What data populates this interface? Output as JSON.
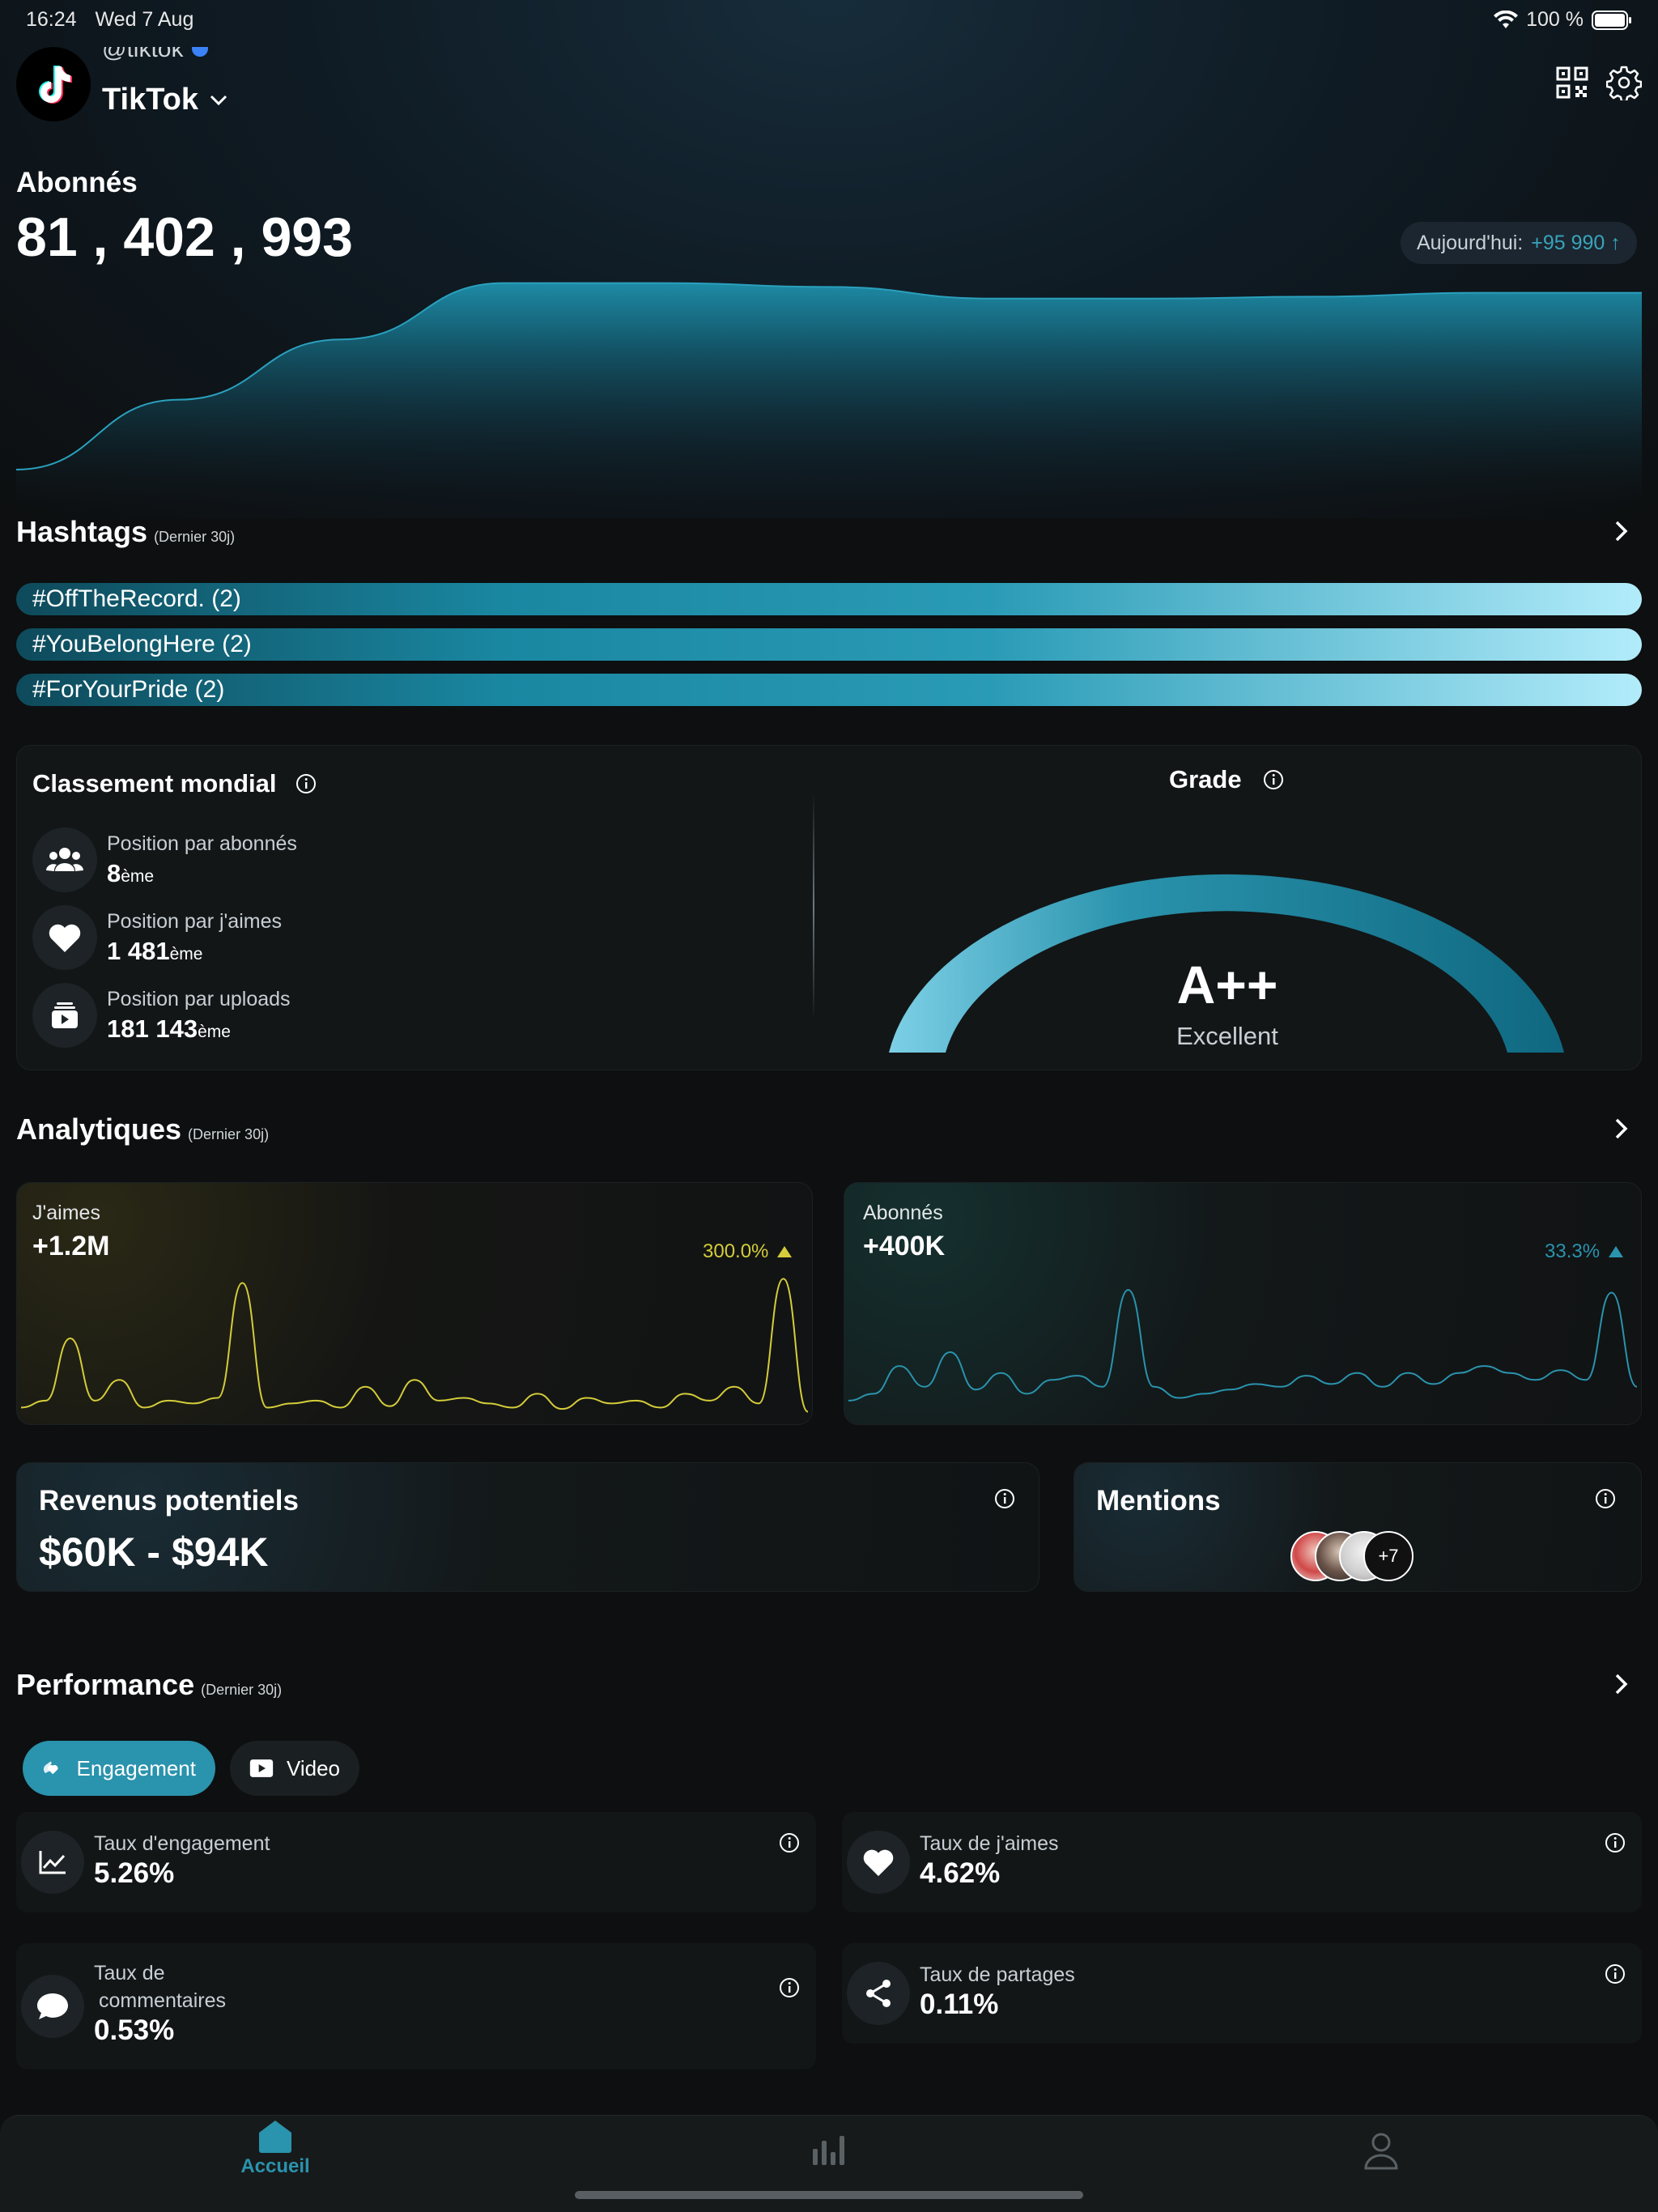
{
  "status_bar": {
    "time": "16:24",
    "date": "Wed 7 Aug",
    "battery": "100 %"
  },
  "profile": {
    "handle": "@tiktok",
    "name": "TikTok"
  },
  "followers": {
    "title": "Abonnés",
    "count": "81 , 402 , 993",
    "today_label": "Aujourd'hui:",
    "today_value": "+95 990 ↑"
  },
  "hashtags": {
    "title": "Hashtags",
    "subtitle": "(Dernier 30j)",
    "items": [
      "#OffTheRecord. (2)",
      "#YouBelongHere (2)",
      "#ForYourPride (2)"
    ]
  },
  "ranking": {
    "title": "Classement mondial",
    "items": [
      {
        "icon": "followers-icon",
        "label": "Position par abonnés",
        "value": "8",
        "suffix": "ème"
      },
      {
        "icon": "heart-icon",
        "label": "Position par j'aimes",
        "value": "1 481",
        "suffix": "ème"
      },
      {
        "icon": "uploads-icon",
        "label": "Position par uploads",
        "value": "181 143",
        "suffix": "ème"
      }
    ],
    "grade_title": "Grade",
    "grade": "A++",
    "grade_label": "Excellent"
  },
  "analytics": {
    "title": "Analytiques",
    "subtitle": "(Dernier 30j)",
    "likes": {
      "label": "J'aimes",
      "value": "+1.2M",
      "change": "300.0%",
      "color": "#d4cc3a"
    },
    "followers": {
      "label": "Abonnés",
      "value": "+400K",
      "change": "33.3%",
      "color": "#2a93ad"
    }
  },
  "revenue": {
    "title": "Revenus potentiels",
    "value": "$60K - $94K"
  },
  "mentions": {
    "title": "Mentions",
    "more": "+7"
  },
  "performance": {
    "title": "Performance",
    "subtitle": "(Dernier 30j)",
    "tabs": [
      "Engagement",
      "Video"
    ],
    "stats": [
      {
        "label": "Taux d'engagement",
        "value": "5.26%"
      },
      {
        "label": "Taux de j'aimes",
        "value": "4.62%"
      },
      {
        "label_line1": "Taux de",
        "label_line2": "commentaires",
        "value": "0.53%"
      },
      {
        "label": "Taux de partages",
        "value": "0.11%"
      }
    ]
  },
  "nav": {
    "home": "Accueil"
  },
  "colors": {
    "accent": "#2a93ad",
    "yellow": "#d4cc3a"
  },
  "chart_data": [
    {
      "type": "area",
      "title": "Abonnés",
      "x": [
        0,
        1,
        2,
        3,
        4,
        5,
        6,
        7,
        8,
        9,
        10
      ],
      "values": [
        0.0,
        0.36,
        0.67,
        0.96,
        0.96,
        0.94,
        0.88,
        0.88,
        0.89,
        0.91,
        0.91
      ]
    },
    {
      "type": "line",
      "title": "J'aimes",
      "values": [
        0.05,
        0.1,
        0.55,
        0.1,
        0.25,
        0.05,
        0.1,
        0.08,
        0.12,
        0.95,
        0.05,
        0.08,
        0.1,
        0.05,
        0.2,
        0.06,
        0.25,
        0.1,
        0.12,
        0.08,
        0.05,
        0.15,
        0.04,
        0.12,
        0.08,
        0.1,
        0.05,
        0.15,
        0.1,
        0.2,
        0.08,
        0.98,
        0.02
      ]
    },
    {
      "type": "line",
      "title": "Abonnés",
      "values": [
        0.1,
        0.15,
        0.35,
        0.2,
        0.45,
        0.18,
        0.3,
        0.15,
        0.25,
        0.28,
        0.2,
        0.9,
        0.2,
        0.12,
        0.15,
        0.18,
        0.22,
        0.2,
        0.28,
        0.22,
        0.3,
        0.2,
        0.3,
        0.22,
        0.3,
        0.35,
        0.3,
        0.25,
        0.32,
        0.25,
        0.88,
        0.2
      ]
    }
  ]
}
